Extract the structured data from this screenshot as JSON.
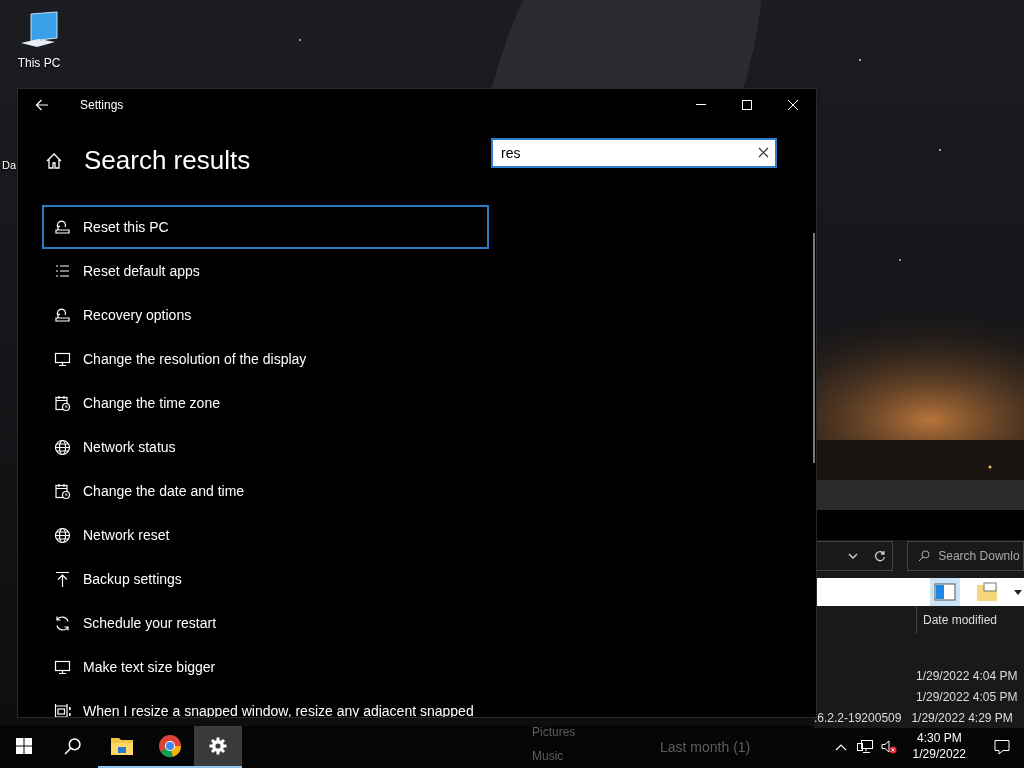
{
  "desktop": {
    "icons": [
      {
        "kind": "computer",
        "label": "This PC"
      },
      {
        "kind": "partial",
        "label": "Da"
      }
    ]
  },
  "settings": {
    "title": "Settings",
    "page_title": "Search results",
    "search": {
      "value": "res"
    },
    "results": [
      {
        "kind": "reset",
        "label": "Reset this PC",
        "selected": true
      },
      {
        "kind": "apps",
        "label": "Reset default apps",
        "selected": false
      },
      {
        "kind": "reset",
        "label": "Recovery options",
        "selected": false
      },
      {
        "kind": "display",
        "label": "Change the resolution of the display",
        "selected": false
      },
      {
        "kind": "calendar",
        "label": "Change the time zone",
        "selected": false
      },
      {
        "kind": "globe",
        "label": "Network status",
        "selected": false
      },
      {
        "kind": "calendar",
        "label": "Change the date and time",
        "selected": false
      },
      {
        "kind": "globe",
        "label": "Network reset",
        "selected": false
      },
      {
        "kind": "backup",
        "label": "Backup settings",
        "selected": false
      },
      {
        "kind": "sync",
        "label": "Schedule your restart",
        "selected": false
      },
      {
        "kind": "display",
        "label": "Make text size bigger",
        "selected": false
      },
      {
        "kind": "snap",
        "label": "When I resize a snapped window, resize any adjacent snapped",
        "selected": false
      }
    ]
  },
  "explorer": {
    "search": {
      "placeholder": "Search Downlo"
    },
    "column": "Date modified",
    "rows": [
      {
        "date": "1/29/2022 4:04 PM"
      },
      {
        "date": "1/29/2022 4:05 PM"
      },
      {
        "name": ".6.2.2-19200509",
        "date": "1/29/2022 4:29 PM"
      }
    ],
    "nav": [
      "Pictures",
      "Music"
    ],
    "group": "Last month (1)"
  },
  "taskbar": {
    "apps": [
      {
        "kind": "start",
        "running": false,
        "active": false
      },
      {
        "kind": "search",
        "running": false,
        "active": false
      },
      {
        "kind": "explorer",
        "running": true,
        "active": false
      },
      {
        "kind": "chrome",
        "running": true,
        "active": false
      },
      {
        "kind": "settings",
        "running": true,
        "active": true
      }
    ],
    "time": "4:30 PM",
    "date": "1/29/2022"
  }
}
